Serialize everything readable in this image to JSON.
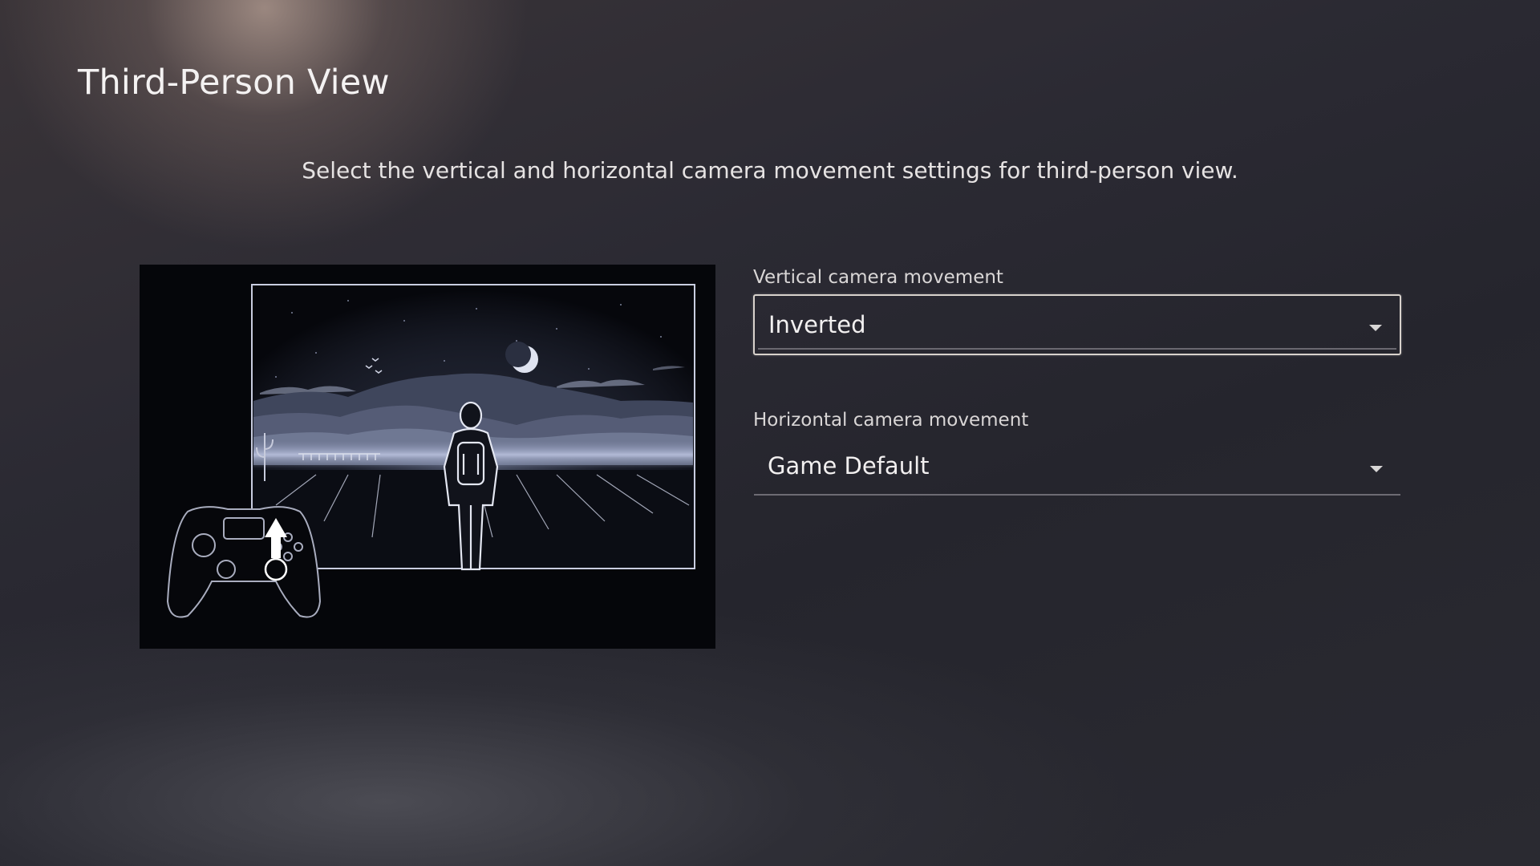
{
  "page": {
    "title": "Third-Person View",
    "description": "Select the vertical and horizontal camera movement settings for third-person view."
  },
  "settings": {
    "vertical": {
      "label": "Vertical camera movement",
      "value": "Inverted",
      "focused": true
    },
    "horizontal": {
      "label": "Horizontal camera movement",
      "value": "Game Default",
      "focused": false
    }
  },
  "illustration": {
    "icons": [
      "controller-icon",
      "up-arrow-icon",
      "moon-icon",
      "character-icon"
    ]
  },
  "colors": {
    "focus_border": "#d8d2cc",
    "text": "#f2f0f0"
  }
}
